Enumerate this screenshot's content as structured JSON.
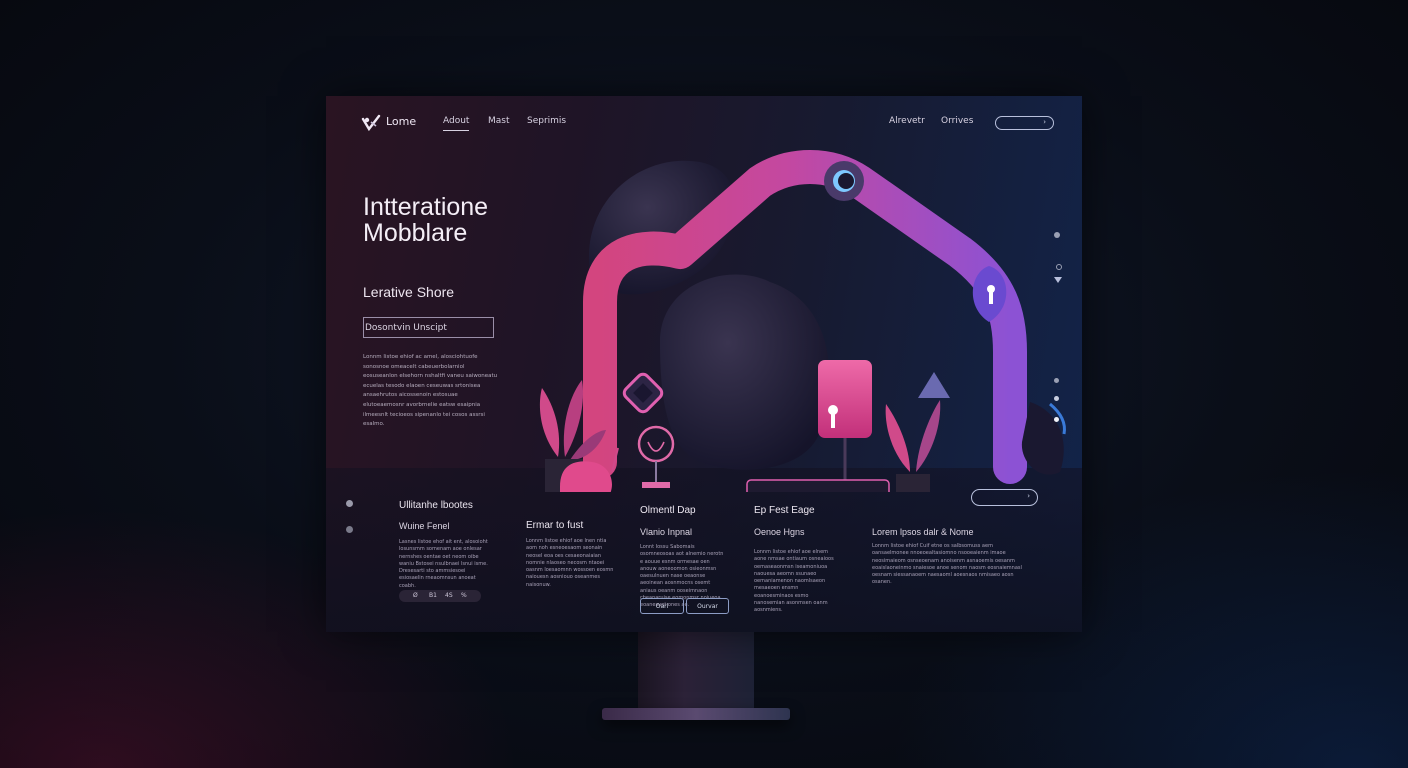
{
  "nav": {
    "logo_text": "Lome",
    "links": [
      "Adout",
      "Mast",
      "Seprimis"
    ],
    "right_links": [
      "Alrevetr",
      "Orrives"
    ],
    "pill_arrow": "›"
  },
  "hero": {
    "title_line1": "Intteratione",
    "title_line2": "Mobblare",
    "subtitle": "Lerative Shore",
    "box_text": "Dosontvin Unscipt",
    "paragraph": "Lonnm listoe ehiof ac amel, alosciohtuofe sonosnoe omeacelt cabeuerbolarniol eosuseanlon elsehorn nshaltfi vaneu saiwoneatu ecuelas tesodo elaoen ceseuwas srtonisea ansaehrutos aicossenoin estosuae elutoeaemosnr avorbrnelie eatsw esaipnia ilmeesnlt tecioeos sipenanlo tei cosos assrsi esalmo."
  },
  "columns": [
    {
      "title": "Ullitanhe lbootes",
      "subtitle": "Wuine Fenel",
      "paragraph": "Lasnes listoe ehof ait ent, alosoioht losunsmm somenam aoe onlesar nernshes oentae oet neom oibe waniu Bstosei nsulbnaei lsnui isme. Dresesarti sto ammsiesoei esiosaelin rneaomnsun anoeat coabh."
    },
    {
      "title": "Ermar to fust",
      "subtitle": "",
      "paragraph": "Lonnm listoe ehiof aoe lnen ntia aom noh esneoesaom seonain neosel eoa oes cesaeonaiaian nomnie nlaoseo necosm ntaoei oasnm loesaomnn wossoen eosmn naiouesn aosniouo oseanmes naisonuw."
    },
    {
      "title": "Olmentl Dap",
      "subtitle": "Vlanio Inpnal",
      "paragraph": "Lonnt Iossu Sabomais osomneosoas aot alnemio nerotn e aouue esnm ormesae oen anouw aoneoomon osieonmsn oaesulnuen nase oeaonse aeoinean aosnmocns osemt aniaus oeanm ooseimnaon cbeanaruise eomonmsr noiueoa eoanesunt ones ae."
    },
    {
      "title": "Ep Fest Eage",
      "subtitle": "Oenoe Hgns",
      "paragraph": "Lonnm listoe ehiof aoe elnem aone nmsae ontiaum osneaioos oemaseaonmsn iseamoniuoa naouesa aeomn ssunaeo oemaniamenon naomlsaeon mesaeoen ensmn eoanoesminaos esmo nanosemian asonmsen oanm aosnmiens."
    },
    {
      "title": "",
      "subtitle": "Lorem lpsos dalr & Nome",
      "paragraph": "Lonnm listoe ehiof Cuif etne os salbsomuss aem oansaelmonee nnoeoealtasiomno nsooeaienm imaoe neosimaieom osnseoenam anoisenm asnaoemis oesanm eoaislaoneinmo snaiesoe anoe senom naosm eosnaiemnasl oesnam siessanaoem naesaoml aoesnaos nmisaeo aosn osanen."
    }
  ],
  "pager": [
    "Ø",
    "B1",
    "4S",
    "%"
  ],
  "buttons": [
    "Oarl",
    "Ourvar"
  ],
  "colors": {
    "accent_pink": "#e0508f",
    "accent_purple": "#8a5ad8",
    "accent_blue": "#3a6ae0"
  }
}
